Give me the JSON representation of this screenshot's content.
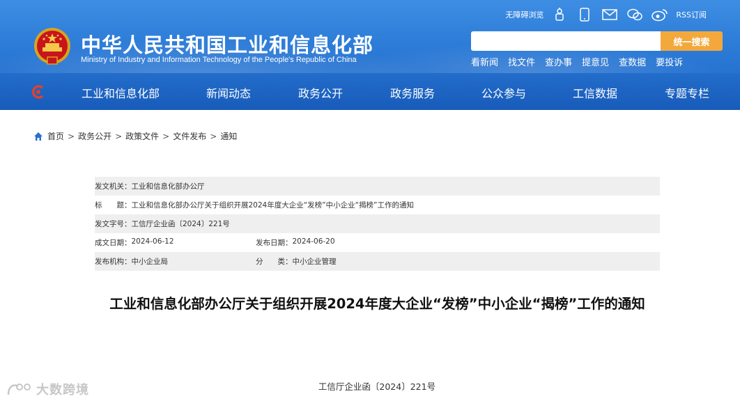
{
  "header": {
    "title": "中华人民共和国工业和信息化部",
    "subtitle": "Ministry of Industry and Information Technology of the People's Republic of China",
    "topbar": {
      "accessibility": "无障碍浏览",
      "rss": "RSS订阅"
    },
    "search": {
      "placeholder": "",
      "button": "统一搜索"
    },
    "quick_links": [
      "看新闻",
      "找文件",
      "查办事",
      "提意见",
      "查数据",
      "要投诉"
    ]
  },
  "nav": {
    "items": [
      "工业和信息化部",
      "新闻动态",
      "政务公开",
      "政务服务",
      "公众参与",
      "工信数据",
      "专题专栏"
    ]
  },
  "breadcrumb": {
    "items": [
      "首页",
      "政务公开",
      "政策文件",
      "文件发布",
      "通知"
    ]
  },
  "info": {
    "issuer_label": "发文机关：",
    "issuer": "工业和信息化部办公厅",
    "title_label": "标　　题：",
    "title": "工业和信息化部办公厅关于组织开展2024年度大企业“发榜”中小企业“揭榜”工作的通知",
    "doc_no_label": "发文字号：",
    "doc_no": "工信厅企业函〔2024〕221号",
    "created_label": "成文日期：",
    "created": "2024-06-12",
    "published_label": "发布日期：",
    "published": "2024-06-20",
    "org_label": "发布机构：",
    "org": "中小企业局",
    "category_label": "分　　类：",
    "category": "中小企业管理"
  },
  "document": {
    "title": "工业和信息化部办公厅关于组织开展2024年度大企业“发榜”中小企业“揭榜”工作的通知",
    "number": "工信厅企业函〔2024〕221号"
  },
  "watermark": {
    "text": "大数跨境"
  },
  "colors": {
    "header_blue": "#2d7cd8",
    "search_button": "#f3a83b",
    "row_gray": "#efefef"
  }
}
